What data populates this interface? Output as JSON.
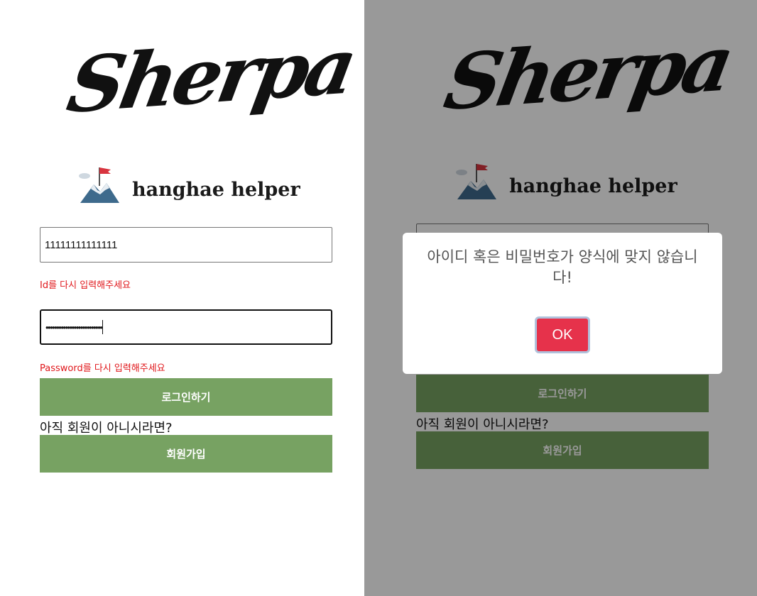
{
  "brand": {
    "name": "Sherpa",
    "tagline": "hanghae helper"
  },
  "login": {
    "id_value": "11111111111111",
    "password_masked": "••••••••••••••••••••••••••",
    "id_error": "Id를 다시 입력해주세요",
    "password_error": "Password를 다시 입력해주세요",
    "login_button": "로그인하기",
    "signup_prompt": "아직 회원이 아니시라면?",
    "signup_button": "회원가입"
  },
  "alert": {
    "message": "아이디 혹은 비밀번호가 양식에 맞지 않습니다!",
    "ok_label": "OK"
  },
  "colors": {
    "primary_button": "#77a262",
    "error_text": "#e0161a",
    "ok_button": "#e6324b"
  }
}
